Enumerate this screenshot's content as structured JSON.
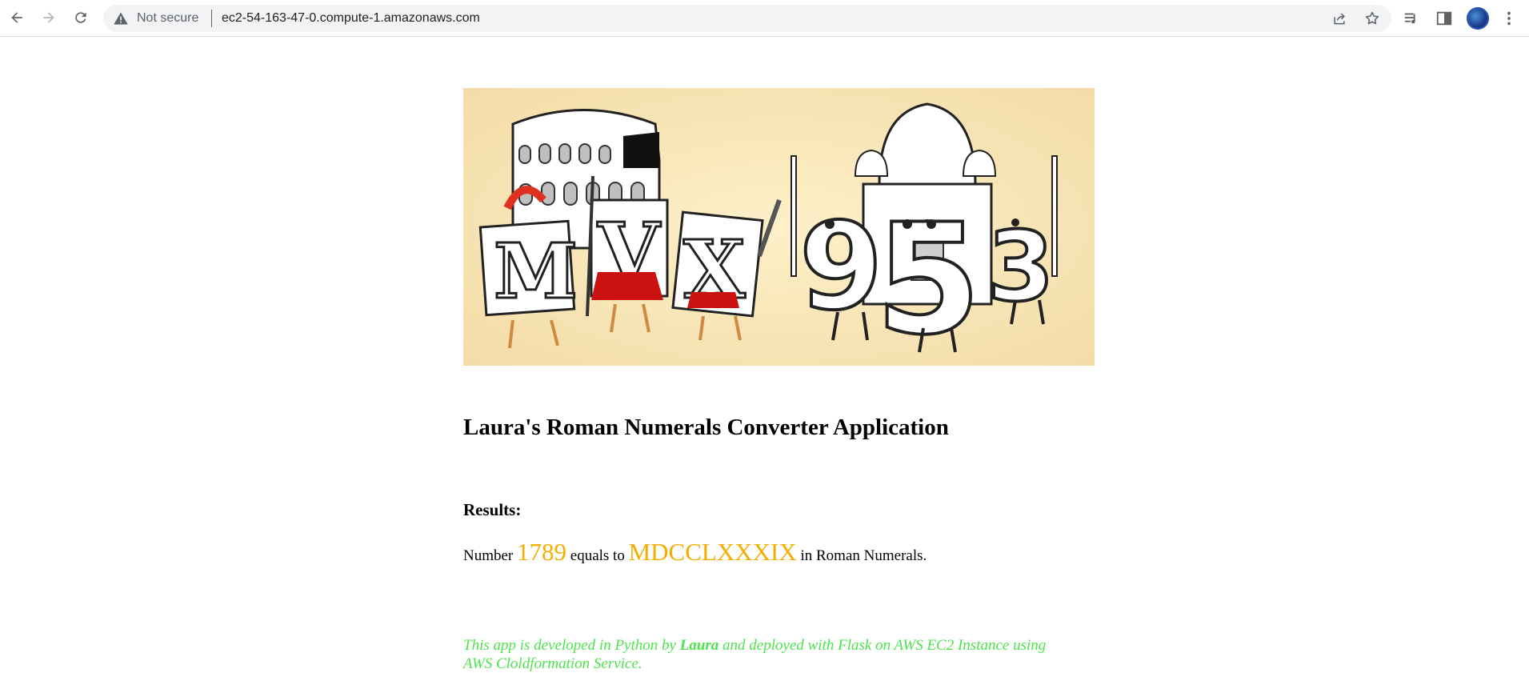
{
  "browser": {
    "security_label": "Not secure",
    "url": "ec2-54-163-47-0.compute-1.amazonaws.com"
  },
  "page": {
    "banner_alt": "Roman numerals M V X and Arabic numerals 9 5 3 cartoon",
    "title": "Laura's Roman Numerals Converter Application",
    "results_label": "Results:",
    "result": {
      "prefix": "Number",
      "number": "1789",
      "middle": "equals to",
      "roman": "MDCCLXXXIX",
      "suffix": "in Roman Numerals."
    },
    "footer": {
      "part1": "This app is developed in Python by",
      "author": "Laura",
      "part2": "and deployed with Flask on AWS EC2 Instance using AWS Cloldformation Service."
    }
  },
  "colors": {
    "highlight": "#f5ad00",
    "footer_text": "#4de34d"
  }
}
